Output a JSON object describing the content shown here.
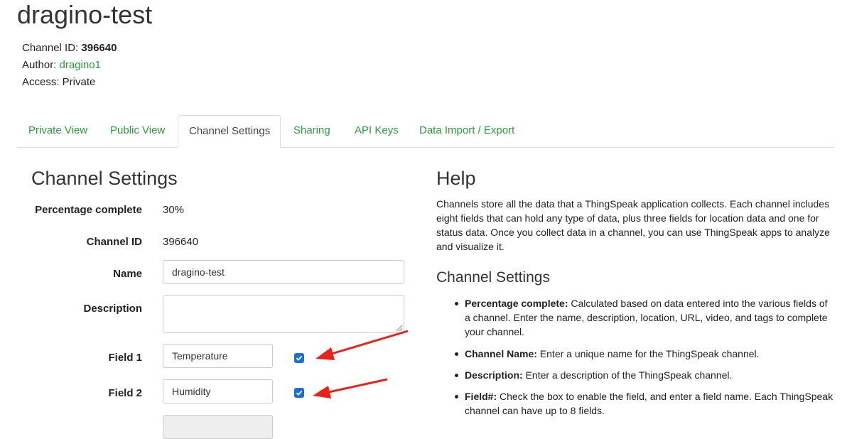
{
  "page": {
    "title": "dragino-test",
    "channel_id_label": "Channel ID: ",
    "channel_id_value": "396640",
    "author_label": "Author: ",
    "author_value": "dragino1",
    "access_text": "Access: Private"
  },
  "tabs": [
    {
      "label": "Private View"
    },
    {
      "label": "Public View"
    },
    {
      "label": "Channel Settings",
      "active": true
    },
    {
      "label": "Sharing"
    },
    {
      "label": "API Keys"
    },
    {
      "label": "Data Import / Export"
    }
  ],
  "settings": {
    "heading": "Channel Settings",
    "percentage_label": "Percentage complete",
    "percentage_value": "30%",
    "channel_id_label": "Channel ID",
    "channel_id_value": "396640",
    "name_label": "Name",
    "name_value": "dragino-test",
    "description_label": "Description",
    "description_value": "",
    "field1_label": "Field 1",
    "field1_value": "Temperature",
    "field1_checked": true,
    "field2_label": "Field 2",
    "field2_value": "Humidity",
    "field2_checked": true
  },
  "help": {
    "heading": "Help",
    "intro": "Channels store all the data that a ThingSpeak application collects. Each channel includes eight fields that can hold any type of data, plus three fields for location data and one for status data. Once you collect data in a channel, you can use ThingSpeak apps to analyze and visualize it.",
    "sub_heading": "Channel Settings",
    "items": [
      {
        "term": "Percentage complete:",
        "text": " Calculated based on data entered into the various fields of a channel. Enter the name, description, location, URL, video, and tags to complete your channel."
      },
      {
        "term": "Channel Name:",
        "text": " Enter a unique name for the ThingSpeak channel."
      },
      {
        "term": "Description:",
        "text": " Enter a description of the ThingSpeak channel."
      },
      {
        "term": "Field#:",
        "text": " Check the box to enable the field, and enter a field name. Each ThingSpeak channel can have up to 8 fields."
      }
    ]
  },
  "colors": {
    "link_green": "#2a9d3a",
    "checkbox_blue": "#1a6fd4",
    "annotation_red": "#e8231a"
  }
}
